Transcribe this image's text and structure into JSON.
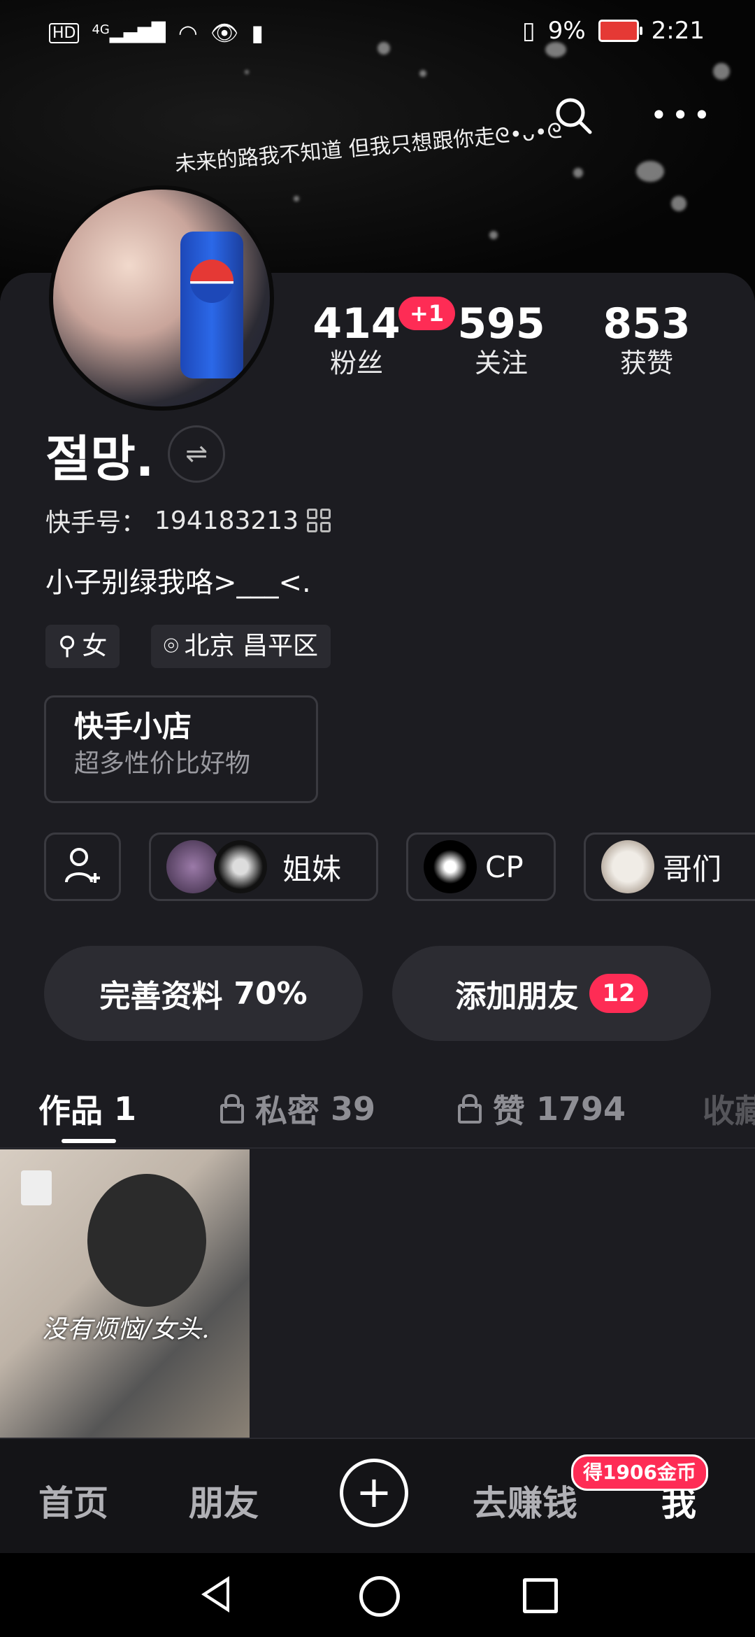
{
  "status_bar": {
    "network": "HD",
    "signal": "4G",
    "battery_percent": "9%",
    "time": "2:21",
    "battery_color": "#e53935"
  },
  "header": {
    "search_icon": "search-icon",
    "more_icon": "more-icon",
    "signature": "未来的路我不知道 但我只想跟你走ᘓ•ᴗ•ᘓ"
  },
  "profile": {
    "stats": [
      {
        "value": "414",
        "label": "粉丝"
      },
      {
        "value": "595",
        "label": "关注"
      },
      {
        "value": "853",
        "label": "获赞"
      }
    ],
    "new_followers_badge": "+1",
    "name": "절망.",
    "switch_icon": "⇌",
    "kuaishou_id_label": "快手号：",
    "kuaishou_id": "194183213",
    "bio": "小子别绿我咯>___<.",
    "tags": [
      {
        "icon": "gender-female-icon",
        "symbol": "⚲",
        "label": "女"
      },
      {
        "icon": "location-pin-icon",
        "symbol": "⌾",
        "label": "北京 昌平区"
      }
    ],
    "shop": {
      "title": "快手小店",
      "subtitle": "超多性价比好物"
    },
    "groups": [
      {
        "label": "姐妹"
      },
      {
        "label": "CP"
      },
      {
        "label": "哥们"
      }
    ],
    "complete_profile": {
      "label": "完善资料",
      "percent": "70%"
    },
    "add_friends": {
      "label": "添加朋友",
      "count": "12"
    }
  },
  "tabs": [
    {
      "label": "作品",
      "count": "1",
      "locked": false
    },
    {
      "label": "私密",
      "count": "39",
      "locked": true
    },
    {
      "label": "赞",
      "count": "1794",
      "locked": true
    },
    {
      "label": "收藏",
      "count": "",
      "locked": false
    }
  ],
  "works": [
    {
      "caption": "没有烦恼/女头."
    }
  ],
  "bottom_nav": {
    "home": "首页",
    "friends": "朋友",
    "plus_symbol": "+",
    "earn": "去赚钱",
    "me": "我",
    "coin_badge": "得1906金币"
  },
  "colors": {
    "accent": "#fe2c55",
    "background": "#1c1c21"
  }
}
